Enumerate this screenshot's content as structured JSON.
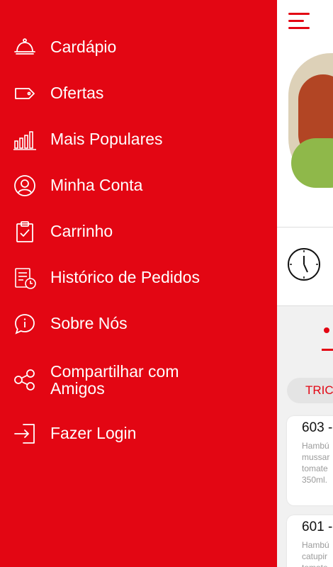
{
  "menu": {
    "items": [
      {
        "label": "Cardápio",
        "icon": "cloche-icon"
      },
      {
        "label": "Ofertas",
        "icon": "tag-icon"
      },
      {
        "label": "Mais Populares",
        "icon": "bar-chart-icon"
      },
      {
        "label": "Minha Conta",
        "icon": "user-icon"
      },
      {
        "label": "Carrinho",
        "icon": "clipboard-check-icon"
      },
      {
        "label": "Histórico de Pedidos",
        "icon": "order-history-icon"
      },
      {
        "label": "Sobre Nós",
        "icon": "info-bubble-icon"
      },
      {
        "label": "Compartilhar com Amigos",
        "icon": "share-icon"
      },
      {
        "label": "Fazer Login",
        "icon": "login-icon"
      }
    ]
  },
  "background": {
    "category_chip": "TRIC",
    "cards": [
      {
        "number": "603 -",
        "desc_lines": [
          "Hambú",
          "mussar",
          "tomate",
          "350ml."
        ]
      },
      {
        "number": "601 -",
        "desc_lines": [
          "Hambú",
          "catupir",
          "tomate"
        ]
      }
    ]
  },
  "colors": {
    "accent": "#e30613",
    "menu_text": "#ffffff"
  }
}
